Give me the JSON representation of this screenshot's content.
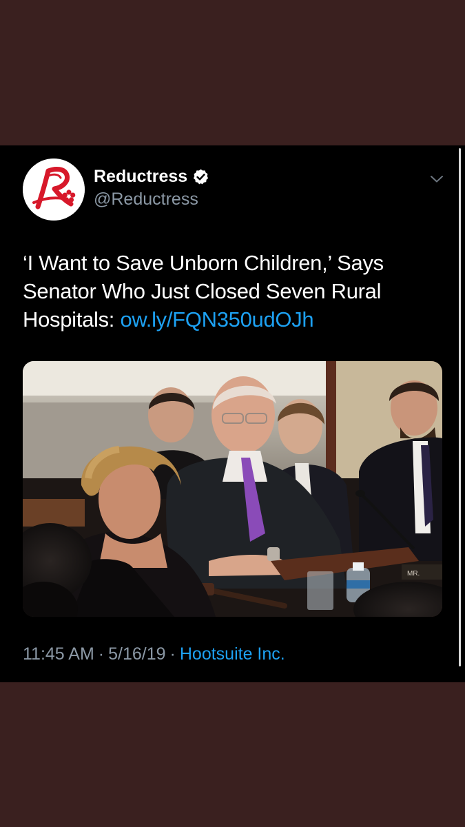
{
  "tweet": {
    "author": {
      "display_name": "Reductress",
      "handle": "@Reductress",
      "verified": true,
      "avatar_icon": "reductress-logo-icon"
    },
    "text_before_link": "‘I Want to Save Unborn Children,’ Says Senator Who Just Closed Seven Rural Hospitals: ",
    "link_text": "ow.ly/FQN350udOJh",
    "media": {
      "type": "photo",
      "name_placard": "MR."
    },
    "time": "11:45 AM",
    "date": "5/16/19",
    "separator": "·",
    "source": "Hootsuite Inc."
  },
  "colors": {
    "background": "#3a201f",
    "card": "#000000",
    "text": "#ffffff",
    "secondary_text": "#8b98a5",
    "link": "#1da1f2",
    "brand_red": "#d7182a"
  }
}
